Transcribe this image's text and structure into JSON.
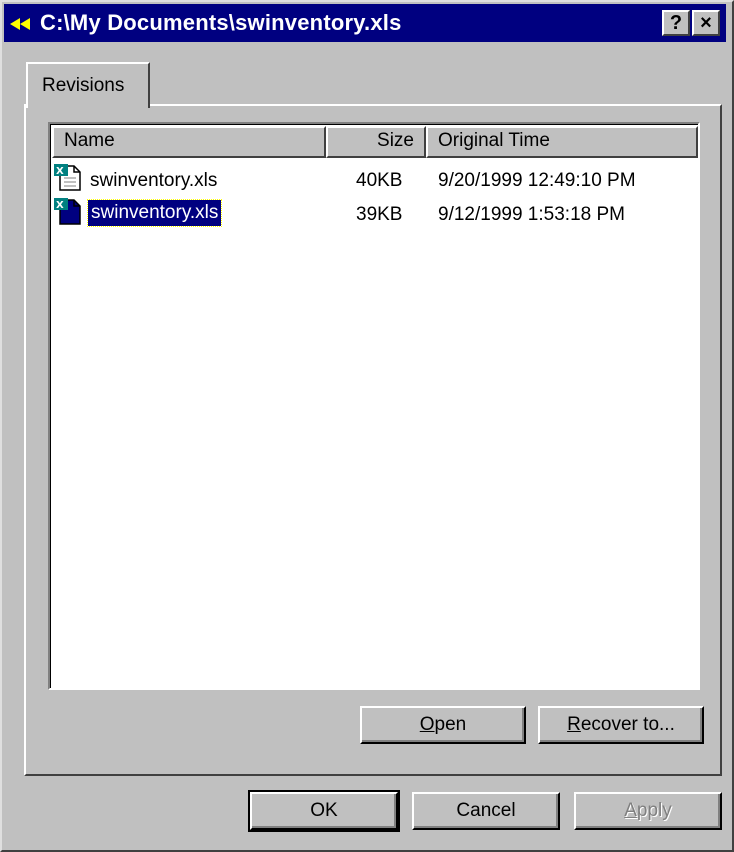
{
  "window": {
    "title": "C:\\My Documents\\swinventory.xls",
    "help_label": "?",
    "close_label": "×"
  },
  "tabs": [
    {
      "label": "Revisions",
      "active": true
    }
  ],
  "list": {
    "columns": [
      "Name",
      "Size",
      "Original Time"
    ],
    "rows": [
      {
        "name": "swinventory.xls",
        "size": "40KB",
        "time": "9/20/1999  12:49:10 PM",
        "selected": false
      },
      {
        "name": "swinventory.xls",
        "size": "39KB",
        "time": "9/12/1999  1:53:18 PM",
        "selected": true
      }
    ]
  },
  "panel_buttons": {
    "open": {
      "mnemonic": "O",
      "rest": "pen"
    },
    "recover": {
      "mnemonic": "R",
      "rest": "ecover to..."
    }
  },
  "dialog_buttons": {
    "ok": "OK",
    "cancel": "Cancel",
    "apply": {
      "mnemonic": "A",
      "rest": "pply",
      "disabled": true
    }
  },
  "colors": {
    "titlebar": "#000080",
    "selection": "#000080",
    "face": "#c0c0c0"
  },
  "icons": {
    "title": "dual-arrow-back-icon",
    "file": "excel-document-icon"
  }
}
